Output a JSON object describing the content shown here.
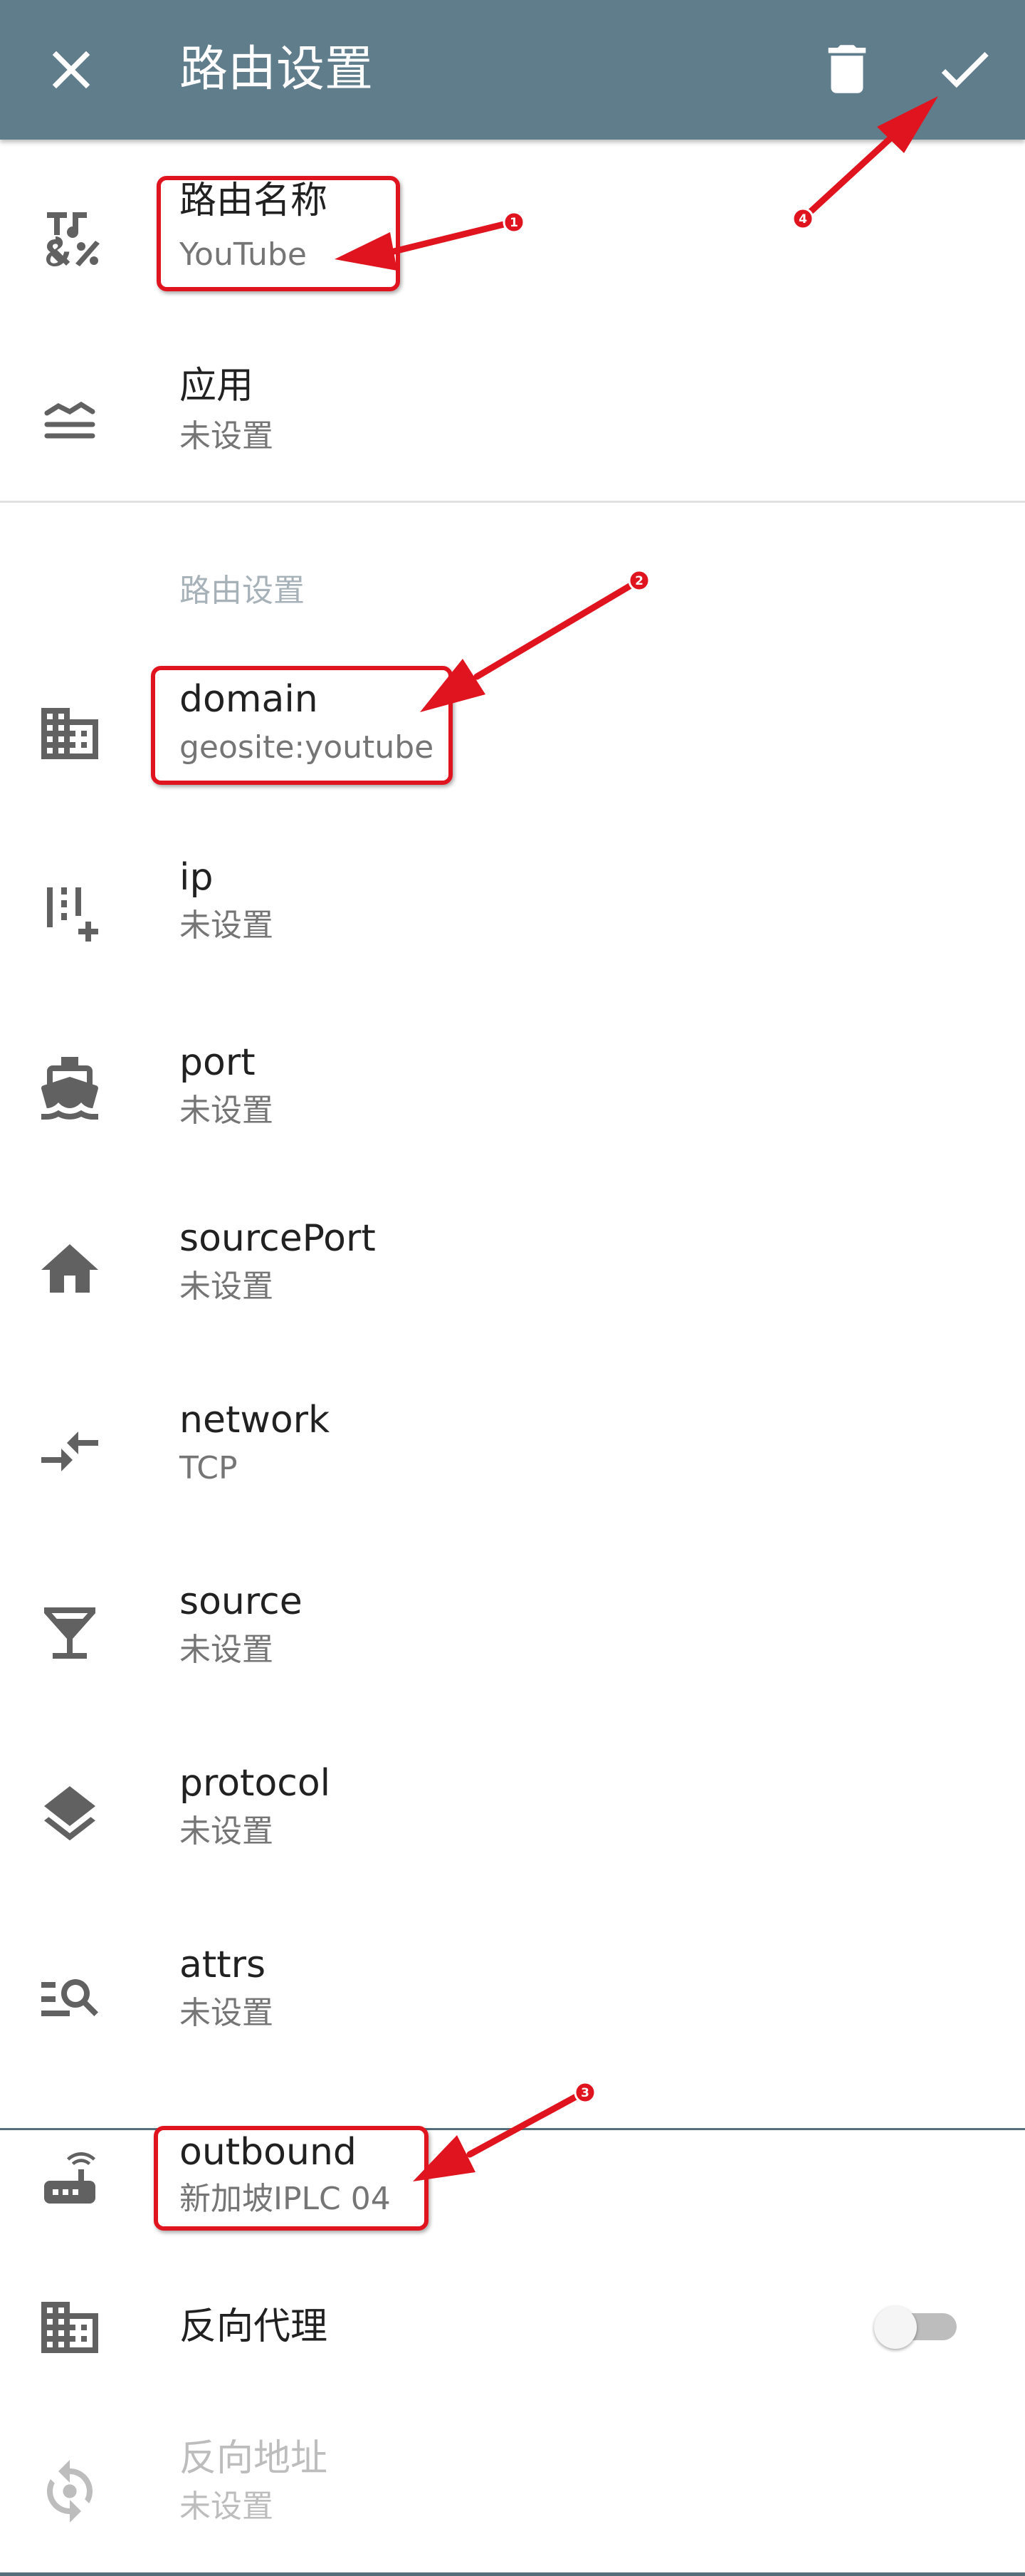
{
  "app_bar": {
    "title": "路由设置",
    "icons": {
      "close": "close-icon",
      "delete": "trash-icon",
      "save": "check-icon"
    }
  },
  "rows": {
    "route_name": {
      "label": "路由名称",
      "value": "YouTube",
      "icon": "format-text-icon"
    },
    "apps": {
      "label": "应用",
      "value": "未设置",
      "icon": "layers-lines-icon"
    },
    "section_title": "路由设置",
    "domain": {
      "label": "domain",
      "value": "geosite:youtube",
      "icon": "domain-building-icon"
    },
    "ip": {
      "label": "ip",
      "value": "未设置",
      "icon": "ip-add-icon"
    },
    "port": {
      "label": "port",
      "value": "未设置",
      "icon": "ship-icon"
    },
    "source_port": {
      "label": "sourcePort",
      "value": "未设置",
      "icon": "home-icon"
    },
    "network": {
      "label": "network",
      "value": "TCP",
      "icon": "compare-arrows-icon"
    },
    "source": {
      "label": "source",
      "value": "未设置",
      "icon": "glass-icon"
    },
    "protocol": {
      "label": "protocol",
      "value": "未设置",
      "icon": "layers-icon"
    },
    "attrs": {
      "label": "attrs",
      "value": "未设置",
      "icon": "search-list-icon"
    },
    "outbound": {
      "label": "outbound",
      "value": "新加坡IPLC 04",
      "icon": "router-icon"
    },
    "reverse_proxy": {
      "label": "反向代理",
      "icon": "domain-building-icon",
      "enabled": false
    },
    "reverse_address": {
      "label": "反向地址",
      "value": "未设置",
      "icon": "sync-icon",
      "disabled": true
    }
  },
  "annotations": {
    "badges": [
      "1",
      "2",
      "3",
      "4"
    ]
  },
  "colors": {
    "app_bar": "#607d8b",
    "annotation": "#e0141e",
    "icon": "#616161"
  }
}
